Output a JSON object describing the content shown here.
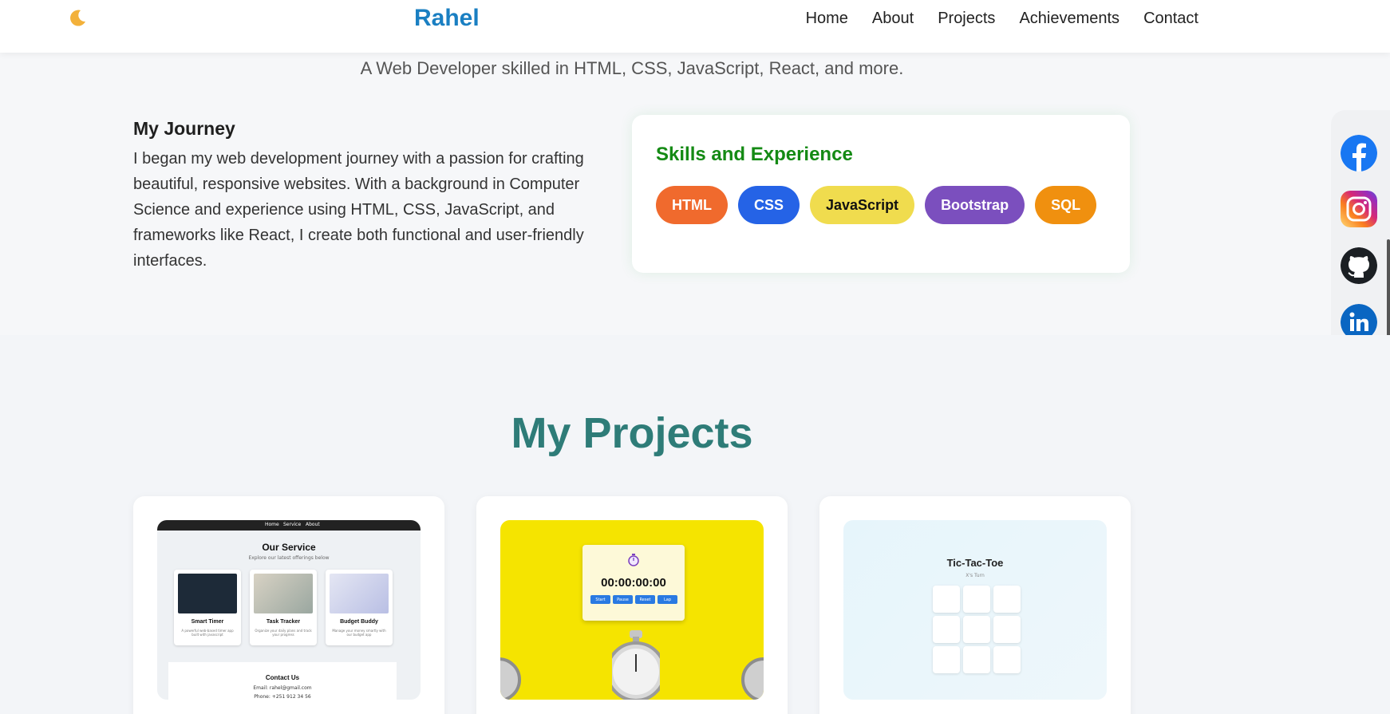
{
  "header": {
    "brand": "Rahel",
    "nav": [
      "Home",
      "About",
      "Projects",
      "Achievements",
      "Contact"
    ]
  },
  "hero": {
    "tagline": "A Web Developer skilled in HTML, CSS, JavaScript, React, and more."
  },
  "journey": {
    "title": "My Journey",
    "text": "I began my web development journey with a passion for crafting beautiful, responsive websites. With a background in Computer Science and experience using HTML, CSS, JavaScript, and frameworks like React, I create both functional and user-friendly interfaces."
  },
  "skills": {
    "title": "Skills and Experience",
    "items": [
      {
        "label": "HTML",
        "color": "#f06a2d",
        "text_color": "#ffffff"
      },
      {
        "label": "CSS",
        "color": "#2563e6",
        "text_color": "#ffffff"
      },
      {
        "label": "JavaScript",
        "color": "#f0dc4e",
        "text_color": "#111111"
      },
      {
        "label": "Bootstrap",
        "color": "#7b4fbe",
        "text_color": "#ffffff"
      },
      {
        "label": "SQL",
        "color": "#f0900f",
        "text_color": "#ffffff"
      }
    ]
  },
  "socials": [
    "facebook-icon",
    "instagram-icon",
    "github-icon",
    "linkedin-icon"
  ],
  "projects": {
    "title": "My Projects",
    "p1": {
      "nav": [
        "Home",
        "Service",
        "About"
      ],
      "heading": "Our Service",
      "subheading": "Explore our latest offerings below",
      "services": [
        {
          "name": "Smart Timer",
          "desc": "A powerful web-based timer app built with javascript"
        },
        {
          "name": "Task Tracker",
          "desc": "Organize your daily plans and track your progress"
        },
        {
          "name": "Budget Buddy",
          "desc": "Manage your money smartly with our budget app"
        }
      ],
      "contact_title": "Contact Us",
      "contact_email": "Email: rahel@gmail.com",
      "contact_phone": "Phone: +251 912 34 56"
    },
    "p2": {
      "time": "00:00:00:00",
      "buttons": [
        "Start",
        "Pause",
        "Reset",
        "Lap"
      ]
    },
    "p3": {
      "title": "Tic-Tac-Toe",
      "turn": "X's Turn"
    }
  },
  "colors": {
    "brand": "#1a7fc2",
    "skills_title": "#148a14",
    "projects_title": "#2e7c78"
  }
}
